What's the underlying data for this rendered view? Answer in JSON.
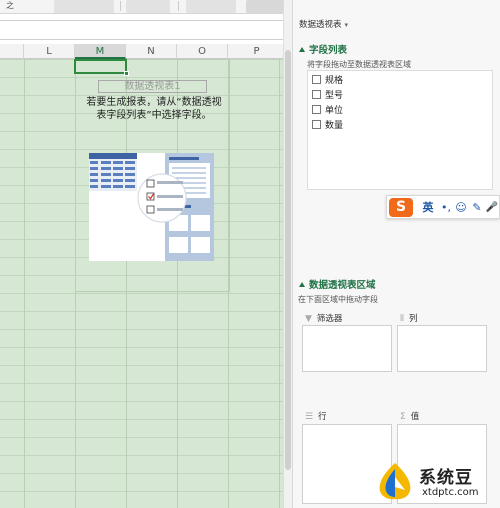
{
  "toolbar": {
    "items": [
      "之",
      "…",
      "…",
      "…"
    ]
  },
  "columns": [
    "L",
    "M",
    "N",
    "O",
    "P"
  ],
  "selected_column": "M",
  "pivot": {
    "title": "数据透视表1",
    "hint": "若要生成报表，请从“数据透视表字段列表”中选择字段。"
  },
  "panel": {
    "header": "数据透视表",
    "field_section_title": "字段列表",
    "field_section_sub": "将字段拖动至数据透视表区域",
    "fields": [
      "规格",
      "型号",
      "单位",
      "数量"
    ],
    "areas_section_title": "数据透视表区域",
    "areas_section_sub": "在下面区域中拖动字段",
    "areas": {
      "filter": "筛选器",
      "columns": "列",
      "rows": "行",
      "values": "值"
    }
  },
  "ime": {
    "logo": "S",
    "lang": "英",
    "items": [
      "•,",
      "☺",
      "✎",
      "🎤"
    ]
  },
  "watermark": {
    "title": "系统豆",
    "url": "xtdptc.com"
  },
  "colors": {
    "accent": "#217346",
    "grid": "#d6e8d3",
    "ime_logo": "#f06a1a"
  }
}
